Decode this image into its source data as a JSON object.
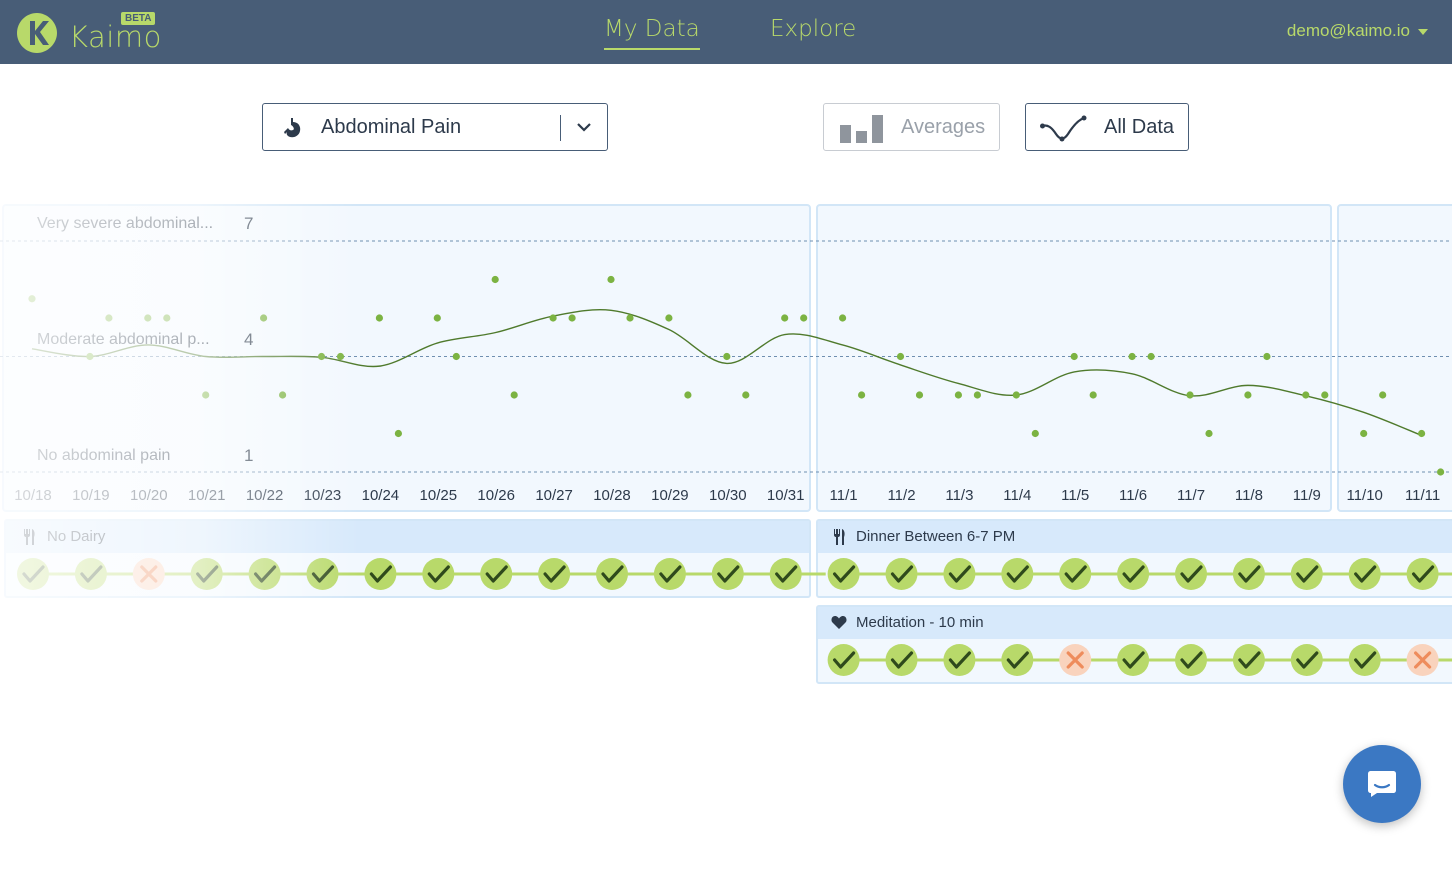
{
  "app": {
    "brand": "Kaimo",
    "badge": "BETA",
    "colors": {
      "nav_bg": "#485d77",
      "accent_green": "#b8d96a",
      "data_green": "#7cb342",
      "miss_orange": "#ee8c5c",
      "chat_blue": "#3b78c3"
    }
  },
  "nav": {
    "tabs": [
      {
        "label": "My Data",
        "active": true
      },
      {
        "label": "Explore",
        "active": false
      }
    ],
    "user": "demo@kaimo.io"
  },
  "controls": {
    "symptom_select": {
      "value": "Abdominal Pain",
      "icon": "stomach-icon"
    },
    "averages_button": {
      "label": "Averages",
      "icon": "bar-chart-icon",
      "active": false
    },
    "all_data_button": {
      "label": "All Data",
      "icon": "line-wave-icon",
      "active": true
    }
  },
  "chart_data": {
    "type": "scatter",
    "title": "",
    "xlabel": "",
    "ylabel": "",
    "ylim": [
      1,
      7
    ],
    "y_ticks": [
      {
        "value": 7,
        "label": "Very severe abdominal..."
      },
      {
        "value": 4,
        "label": "Moderate abdominal p..."
      },
      {
        "value": 1,
        "label": "No abdominal pain"
      }
    ],
    "categories": [
      "10/18",
      "10/19",
      "10/20",
      "10/21",
      "10/22",
      "10/23",
      "10/24",
      "10/25",
      "10/26",
      "10/27",
      "10/28",
      "10/29",
      "10/30",
      "10/31",
      "11/1",
      "11/2",
      "11/3",
      "11/4",
      "11/5",
      "11/6",
      "11/7",
      "11/8",
      "11/9",
      "11/10",
      "11/11"
    ],
    "points": [
      {
        "x": "10/18",
        "y": [
          5.5
        ]
      },
      {
        "x": "10/19",
        "y": [
          4.0,
          5.0
        ]
      },
      {
        "x": "10/20",
        "y": [
          5.0,
          5.0
        ]
      },
      {
        "x": "10/21",
        "y": [
          3.0
        ]
      },
      {
        "x": "10/22",
        "y": [
          5.0,
          3.0
        ]
      },
      {
        "x": "10/23",
        "y": [
          4.0,
          4.0
        ]
      },
      {
        "x": "10/24",
        "y": [
          5.0,
          2.0
        ]
      },
      {
        "x": "10/25",
        "y": [
          5.0,
          4.0
        ]
      },
      {
        "x": "10/26",
        "y": [
          6.0,
          3.0
        ]
      },
      {
        "x": "10/27",
        "y": [
          5.0,
          5.0
        ]
      },
      {
        "x": "10/28",
        "y": [
          6.0,
          5.0
        ]
      },
      {
        "x": "10/29",
        "y": [
          5.0,
          3.0
        ]
      },
      {
        "x": "10/30",
        "y": [
          4.0,
          3.0
        ]
      },
      {
        "x": "10/31",
        "y": [
          5.0,
          5.0
        ]
      },
      {
        "x": "11/1",
        "y": [
          5.0,
          3.0
        ]
      },
      {
        "x": "11/2",
        "y": [
          4.0,
          3.0
        ]
      },
      {
        "x": "11/3",
        "y": [
          3.0,
          3.0
        ]
      },
      {
        "x": "11/4",
        "y": [
          3.0,
          2.0
        ]
      },
      {
        "x": "11/5",
        "y": [
          4.0,
          3.0
        ]
      },
      {
        "x": "11/6",
        "y": [
          4.0,
          4.0
        ]
      },
      {
        "x": "11/7",
        "y": [
          3.0,
          2.0
        ]
      },
      {
        "x": "11/8",
        "y": [
          3.0,
          4.0
        ]
      },
      {
        "x": "11/9",
        "y": [
          3.0,
          3.0
        ]
      },
      {
        "x": "11/10",
        "y": [
          2.0,
          3.0
        ]
      },
      {
        "x": "11/11",
        "y": [
          2.0,
          1.0
        ]
      }
    ],
    "trend": [
      4.2,
      4.0,
      4.3,
      4.0,
      4.0,
      3.98,
      3.75,
      4.35,
      4.62,
      5.05,
      5.2,
      4.7,
      3.82,
      4.57,
      4.3,
      3.78,
      3.3,
      3.0,
      3.6,
      3.55,
      2.98,
      3.25,
      2.98,
      2.55,
      1.95
    ],
    "grid": true,
    "legend": "none"
  },
  "habits": [
    {
      "title": "No Dairy",
      "icon": "utensils-icon",
      "results": [
        {
          "date": "10/18",
          "status": "done"
        },
        {
          "date": "10/19",
          "status": "done"
        },
        {
          "date": "10/20",
          "status": "missed"
        },
        {
          "date": "10/21",
          "status": "done"
        },
        {
          "date": "10/22",
          "status": "done"
        },
        {
          "date": "10/23",
          "status": "done"
        },
        {
          "date": "10/24",
          "status": "done"
        },
        {
          "date": "10/25",
          "status": "done"
        },
        {
          "date": "10/26",
          "status": "done"
        },
        {
          "date": "10/27",
          "status": "done"
        },
        {
          "date": "10/28",
          "status": "done"
        },
        {
          "date": "10/29",
          "status": "done"
        },
        {
          "date": "10/30",
          "status": "done"
        },
        {
          "date": "10/31",
          "status": "done"
        }
      ]
    },
    {
      "title": "Dinner Between 6-7 PM",
      "icon": "utensils-icon",
      "results": [
        {
          "date": "11/1",
          "status": "done"
        },
        {
          "date": "11/2",
          "status": "done"
        },
        {
          "date": "11/3",
          "status": "done"
        },
        {
          "date": "11/4",
          "status": "done"
        },
        {
          "date": "11/5",
          "status": "done"
        },
        {
          "date": "11/6",
          "status": "done"
        },
        {
          "date": "11/7",
          "status": "done"
        },
        {
          "date": "11/8",
          "status": "done"
        },
        {
          "date": "11/9",
          "status": "done"
        },
        {
          "date": "11/10",
          "status": "done"
        },
        {
          "date": "11/11",
          "status": "done"
        }
      ]
    },
    {
      "title": "Meditation - 10 min",
      "icon": "heart-icon",
      "results": [
        {
          "date": "11/1",
          "status": "done"
        },
        {
          "date": "11/2",
          "status": "done"
        },
        {
          "date": "11/3",
          "status": "done"
        },
        {
          "date": "11/4",
          "status": "done"
        },
        {
          "date": "11/5",
          "status": "missed"
        },
        {
          "date": "11/6",
          "status": "done"
        },
        {
          "date": "11/7",
          "status": "done"
        },
        {
          "date": "11/8",
          "status": "done"
        },
        {
          "date": "11/9",
          "status": "done"
        },
        {
          "date": "11/10",
          "status": "done"
        },
        {
          "date": "11/11",
          "status": "missed"
        }
      ]
    }
  ],
  "chat": {
    "icon": "chat-bubble-icon"
  }
}
